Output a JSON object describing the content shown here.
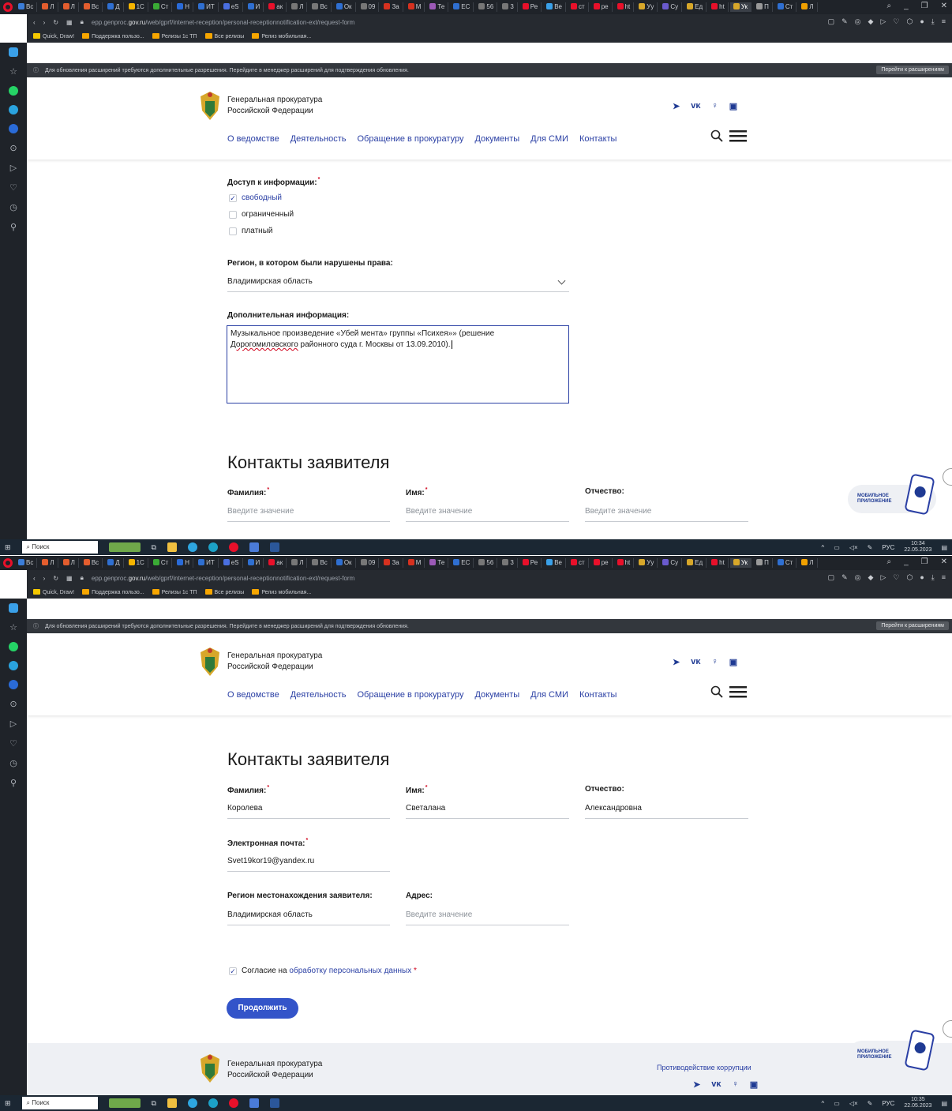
{
  "browser": {
    "tabs": [
      "Вс",
      "Л",
      "Л",
      "Вс",
      "Д",
      "1С",
      "Ст",
      "Н",
      "ИТ",
      "eS",
      "И",
      "ак",
      "Л",
      "Вс",
      "Ок",
      "09",
      "За",
      "М",
      "Те",
      "ЕС",
      "56",
      "3",
      "Ре",
      "Ве",
      "ст",
      "ре",
      "ht",
      "Уу",
      "Су",
      "Ед",
      "ht",
      "Ук",
      "П",
      "Ст",
      "Л"
    ],
    "active_tab": "Ук",
    "url_prefix": "epp.genproc.",
    "url_domain": "gov.ru",
    "url_path": "/web/gprf/internet-reception/personal-receptionnotification-ext/request-form",
    "bookmarks": [
      "Quick, Draw!",
      "Поддержка пользо...",
      "Релизы 1с ТП",
      "Все релизы",
      "Релиз мобильная..."
    ],
    "notice_text": "Для обновления расширений требуются дополнительные разрешения. Перейдите в менеджер расширений для подтверждения обновления.",
    "notice_button": "Перейти к расширениям"
  },
  "taskbar": {
    "search_label": "Поиск",
    "lang": "РУС",
    "time1": "10:34",
    "date1": "22.05.2023",
    "time2": "10:35",
    "date2": "22.05.2023"
  },
  "site": {
    "org_line1": "Генеральная прокуратура",
    "org_line2": "Российской Федерации",
    "nav": [
      "О ведомстве",
      "Деятельность",
      "Обращение в прокуратуру",
      "Документы",
      "Для СМИ",
      "Контакты"
    ],
    "mobile_app_line1": "МОБИЛЬНОЕ",
    "mobile_app_line2": "ПРИЛОЖЕНИЕ",
    "footer_link": "Противодействие коррупции"
  },
  "form1": {
    "access_label": "Доступ к информации:",
    "access_options": [
      {
        "label": "свободный",
        "checked": true
      },
      {
        "label": "ограниченный",
        "checked": false
      },
      {
        "label": "платный",
        "checked": false
      }
    ],
    "region_label": "Регион, в котором были нарушены права:",
    "region_value": "Владимирская область",
    "extra_label": "Дополнительная информация:",
    "extra_text_line1": "Музыкальное произведение «Убей мента» группы «Психея»» (решение",
    "extra_text_line2a": "Дорогомиловского",
    "extra_text_line2b": " районного суда г. Москвы от 13.09.2010)."
  },
  "contacts": {
    "section_title": "Контакты заявителя",
    "surname_label": "Фамилия:",
    "name_label": "Имя:",
    "patronymic_label": "Отчество:",
    "placeholder": "Введите значение",
    "surname_value": "Королева",
    "name_value": "Светалана",
    "patronymic_value": "Александровна",
    "email_label": "Электронная почта:",
    "email_value": "Svet19kor19@yandex.ru",
    "applicant_region_label": "Регион местонахождения заявителя:",
    "applicant_region_value": "Владимирская область",
    "address_label": "Адрес:",
    "consent_prefix": "Согласие на ",
    "consent_link": "обработку персональных данных",
    "consent_star": "*",
    "continue_button": "Продолжить"
  }
}
